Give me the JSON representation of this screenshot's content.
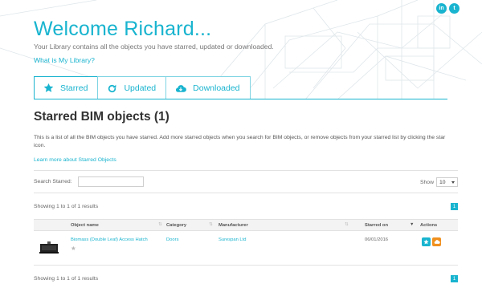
{
  "social": {
    "linkedin": "in",
    "twitter": "t"
  },
  "header": {
    "welcome": "Welcome Richard...",
    "intro": "Your Library contains all the objects you have starred, updated or downloaded.",
    "what_is_link": "What is My Library?"
  },
  "tabs": [
    {
      "label": "Starred",
      "icon": "star-icon",
      "active": true
    },
    {
      "label": "Updated",
      "icon": "refresh-icon",
      "active": false
    },
    {
      "label": "Downloaded",
      "icon": "cloud-download-icon",
      "active": false
    }
  ],
  "section": {
    "title": "Starred BIM objects (1)",
    "description": "This is a list of all the BIM objects you have starred. Add more starred objects when you search for BIM objects, or remove objects from your starred list by clicking the star icon.",
    "learn_more": "Learn more about Starred Objects"
  },
  "search": {
    "label": "Search Starred:",
    "value": "",
    "placeholder": ""
  },
  "show": {
    "label": "Show",
    "value": "10"
  },
  "results": {
    "top": "Showing 1 to 1 of 1 results",
    "bottom": "Showing 1 to 1 of 1 results",
    "page": "1"
  },
  "table": {
    "headers": {
      "name": "Object name",
      "category": "Category",
      "manufacturer": "Manufacturer",
      "starred_on": "Starred on",
      "actions": "Actions"
    },
    "rows": [
      {
        "name": "Biomass (Double Leaf) Access Hatch",
        "category": "Doors",
        "manufacturer": "Surespan Ltd",
        "starred_on": "06/01/2016",
        "star": "★"
      }
    ]
  },
  "colors": {
    "accent": "#19b4cf",
    "download": "#f0901f"
  }
}
